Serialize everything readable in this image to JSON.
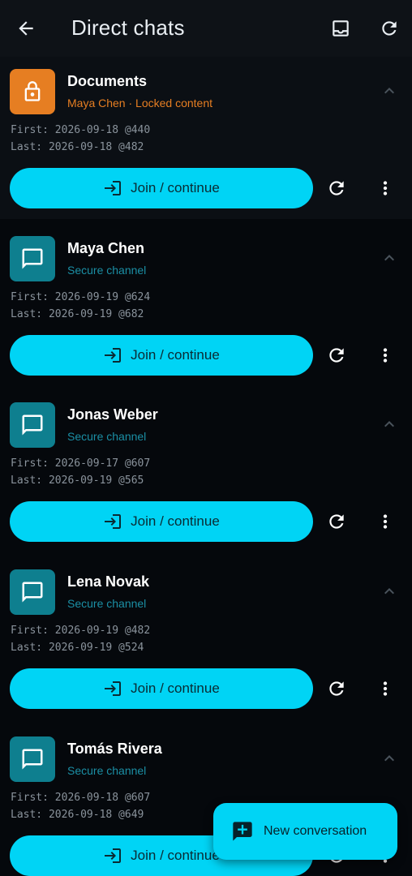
{
  "appbar": {
    "title": "Direct chats",
    "back_icon": "arrow-left-icon",
    "inbox_icon": "inbox-icon",
    "refresh_icon": "refresh-icon"
  },
  "colors": {
    "accent": "#00d4f5",
    "locked": "#e67e22",
    "channel": "#0e7f8f",
    "background": "#05080c"
  },
  "chats": [
    {
      "name": "Documents",
      "subtitle": "Maya Chen · Locked content",
      "first": "First: 2026-09-18 @440",
      "last": "Last: 2026-09-18 @482",
      "join_label": "Join / continue",
      "icon": "lock-icon"
    },
    {
      "name": "Maya Chen",
      "subtitle": "Secure channel",
      "first": "First: 2026-09-19 @624",
      "last": "Last: 2026-09-19 @682",
      "join_label": "Join / continue",
      "icon": "chat-icon"
    },
    {
      "name": "Jonas Weber",
      "subtitle": "Secure channel",
      "first": "First: 2026-09-17 @607",
      "last": "Last: 2026-09-19 @565",
      "join_label": "Join / continue",
      "icon": "chat-icon"
    },
    {
      "name": "Lena Novak",
      "subtitle": "Secure channel",
      "first": "First: 2026-09-19 @482",
      "last": "Last: 2026-09-19 @524",
      "join_label": "Join / continue",
      "icon": "chat-icon"
    },
    {
      "name": "Tomás Rivera",
      "subtitle": "Secure channel",
      "first": "First: 2026-09-18 @607",
      "last": "Last: 2026-09-18 @649",
      "join_label": "Join / continue",
      "icon": "chat-icon"
    }
  ],
  "fab": {
    "label": "New conversation",
    "icon": "add-chat-icon"
  }
}
